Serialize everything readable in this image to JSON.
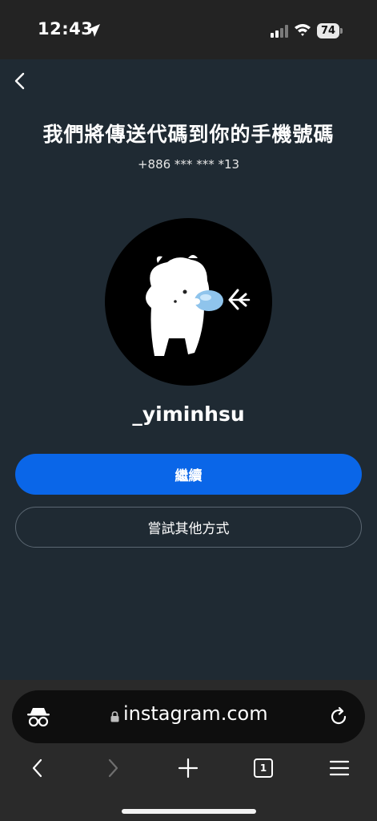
{
  "status_bar": {
    "time": "12:43",
    "battery": "74"
  },
  "page": {
    "title": "我們將傳送代碼到你的手機號碼",
    "phone_number": "+886 *** *** *13",
    "username": "_yiminhsu",
    "continue_label": "繼續",
    "other_methods_label": "嘗試其他方式"
  },
  "browser": {
    "url": "instagram.com",
    "tab_count": "1"
  },
  "colors": {
    "background": "#1f2a33",
    "primary_button": "#0a66e8",
    "status_bar": "#232323",
    "browser_bar": "#2a2a2a"
  }
}
